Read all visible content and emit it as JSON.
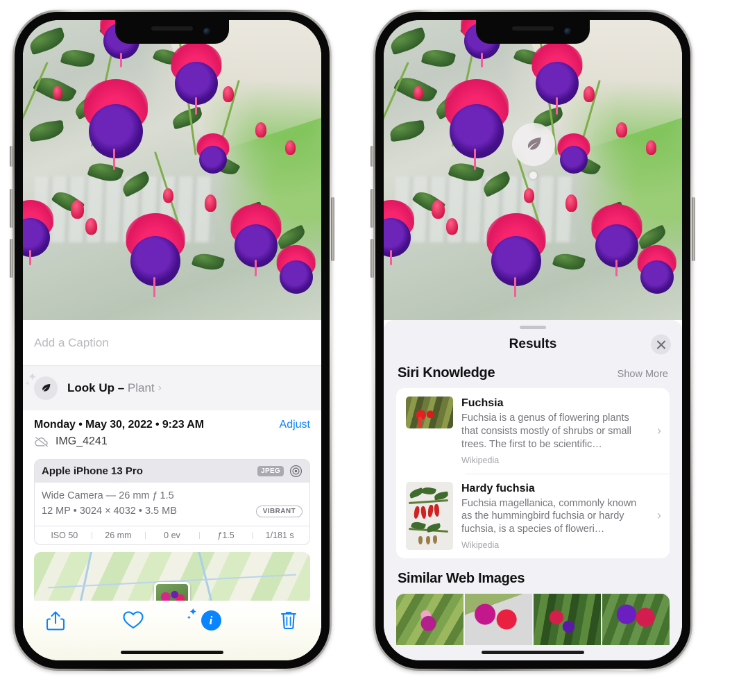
{
  "left_phone": {
    "caption": {
      "placeholder": "Add a Caption",
      "value": ""
    },
    "look_up": {
      "label": "Look Up",
      "dash": " – ",
      "subject": "Plant",
      "chevron": "›",
      "icon": "leaf-icon"
    },
    "meta": {
      "date": "Monday • May 30, 2022 • 9:23 AM",
      "adjust_label": "Adjust",
      "filename": "IMG_4241",
      "cloud_icon": "cloud-slash-icon"
    },
    "exif": {
      "device": "Apple iPhone 13 Pro",
      "format_tag": "JPEG",
      "aperture_icon": "aperture-icon",
      "lens_line": "Wide Camera — 26 mm ƒ 1.5",
      "size_line": "12 MP • 3024 × 4032 • 3.5 MB",
      "style_tag": "VIBRANT",
      "stats": [
        "ISO 50",
        "26 mm",
        "0 ev",
        "ƒ1.5",
        "1/181 s"
      ]
    },
    "map": {
      "pin_icon": "photo-pin"
    },
    "toolbar": [
      {
        "name": "share-button",
        "icon": "share-icon",
        "label": "Share"
      },
      {
        "name": "favorite-button",
        "icon": "heart-icon",
        "label": "Favorite"
      },
      {
        "name": "info-button",
        "icon": "info-sparkle-icon",
        "label": "Info",
        "glyph": "i",
        "active": true
      },
      {
        "name": "delete-button",
        "icon": "trash-icon",
        "label": "Delete"
      }
    ]
  },
  "right_phone": {
    "visual_lookup_badge": {
      "icon": "leaf-icon"
    },
    "sheet": {
      "title": "Results",
      "close_label": "Close",
      "sections": [
        {
          "title": "Siri Knowledge",
          "action": "Show More",
          "items": [
            {
              "title": "Fuchsia",
              "description": "Fuchsia is a genus of flowering plants that consists mostly of shrubs or small trees. The first to be scientific…",
              "source": "Wikipedia",
              "chevron": "›"
            },
            {
              "title": "Hardy fuchsia",
              "description": "Fuchsia magellanica, commonly known as the hummingbird fuchsia or hardy fuchsia, is a species of floweri…",
              "source": "Wikipedia",
              "chevron": "›"
            }
          ]
        },
        {
          "title": "Similar Web Images",
          "images": [
            "fuchsia-web-image-1",
            "fuchsia-web-image-2",
            "fuchsia-web-image-3",
            "fuchsia-web-image-4"
          ]
        }
      ]
    }
  },
  "colors": {
    "accent_blue": "#0a84ff",
    "sheet_bg": "#f2f1f6",
    "card_bg": "#ffffff",
    "secondary_text": "#8e8e93",
    "exif_header_bg": "#e7e7ec"
  }
}
